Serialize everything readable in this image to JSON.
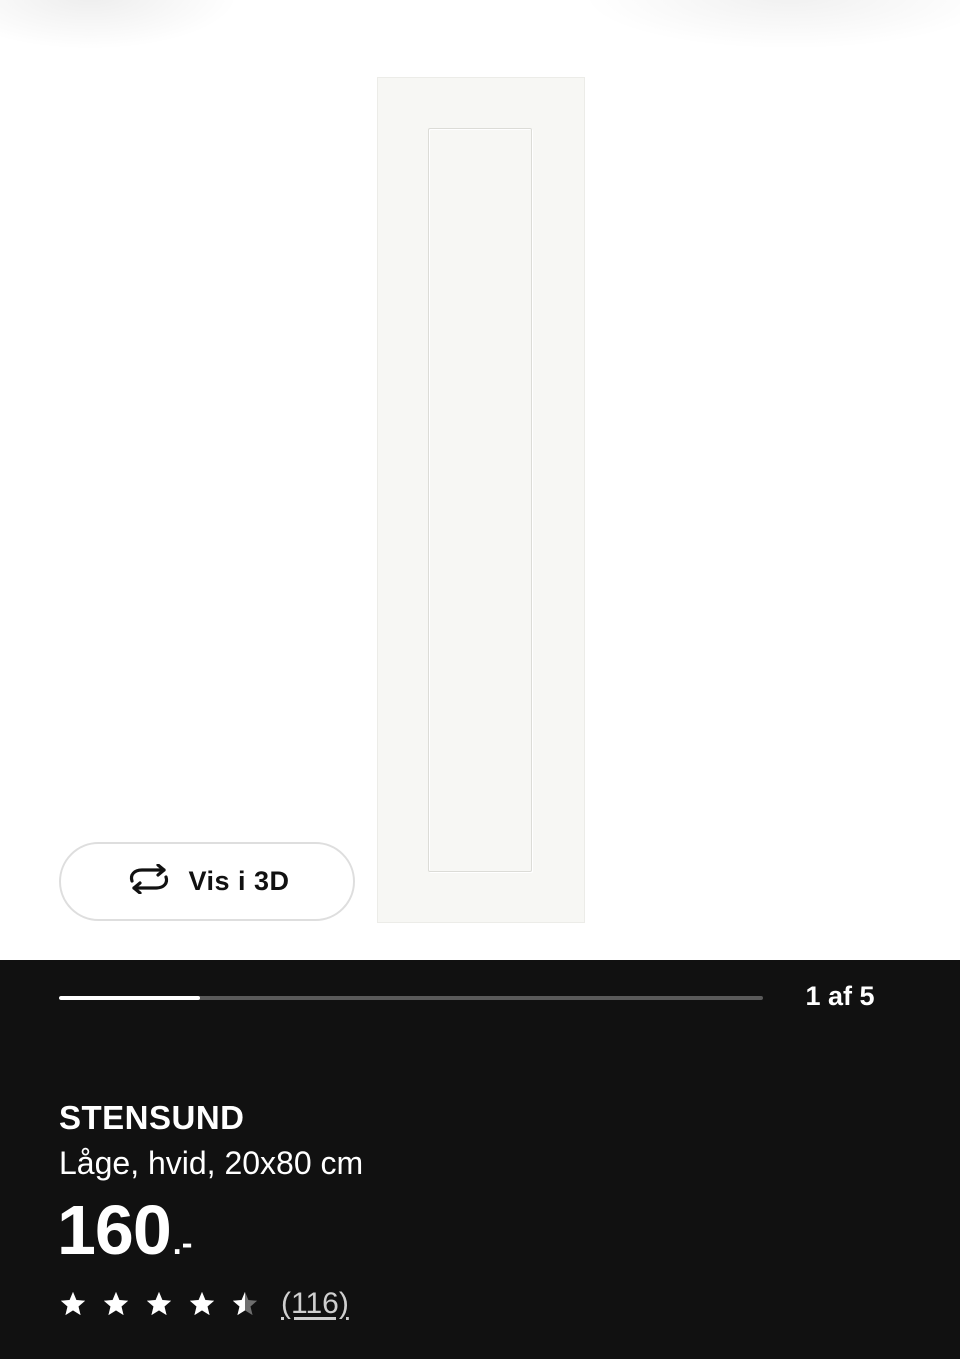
{
  "gallery": {
    "view_3d_label": "Vis i 3D",
    "view_3d_icon": "rotate-3d-icon",
    "progress_fraction": 0.2,
    "counter": "1 af 5"
  },
  "product": {
    "name": "STENSUND",
    "description": "Låge, hvid, 20x80 cm",
    "price_integer": "160",
    "price_suffix": ".-",
    "rating": 4.5,
    "rating_max": 5,
    "review_count": "(116)"
  },
  "colors": {
    "background_dark": "#111111",
    "gallery_background": "#ffffff",
    "text_primary": "#ffffff",
    "progress_track": "#5a5a5a",
    "progress_fill": "#ffffff"
  }
}
